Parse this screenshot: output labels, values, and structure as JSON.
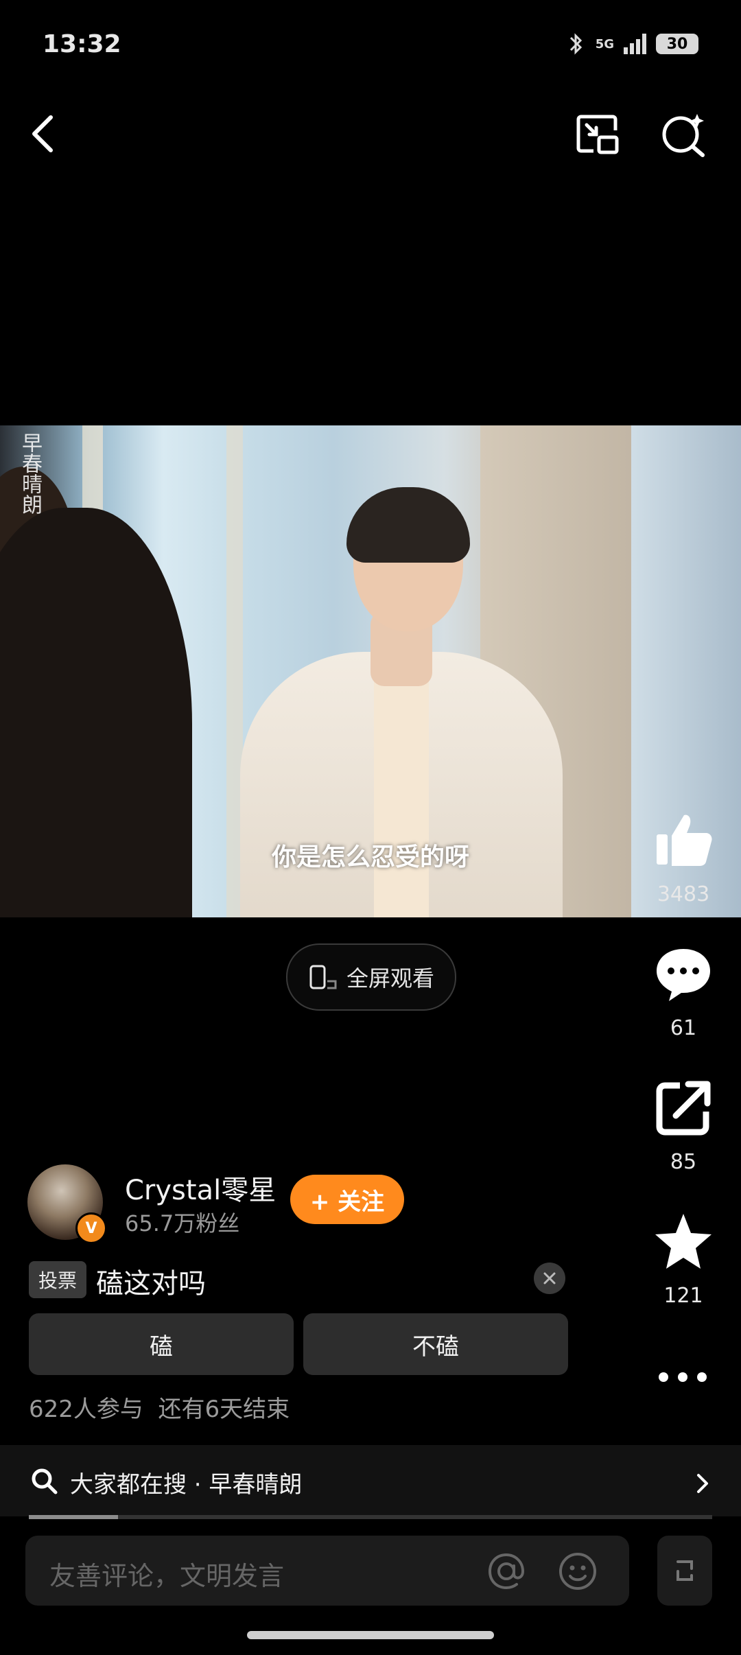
{
  "status": {
    "time": "13:32",
    "network": "5G",
    "battery": "30"
  },
  "video": {
    "watermark": "早春晴朗",
    "subtitle": "你是怎么忍受的呀"
  },
  "fullscreen": {
    "label": "全屏观看"
  },
  "actions": {
    "like_count": "3483",
    "comment_count": "61",
    "share_count": "85",
    "favorite_count": "121"
  },
  "author": {
    "name": "Crystal零星",
    "fans": "65.7万粉丝",
    "follow_label": "+ 关注"
  },
  "vote": {
    "tag": "投票",
    "question": "磕这对吗",
    "options": [
      "磕",
      "不磕"
    ],
    "stats": "622人参与  还有6天结束"
  },
  "search_bar": {
    "text": "大家都在搜 · 早春晴朗"
  },
  "comment": {
    "placeholder": "友善评论，文明发言"
  },
  "colors": {
    "accent": "#ff8a1d",
    "background": "#000000"
  }
}
